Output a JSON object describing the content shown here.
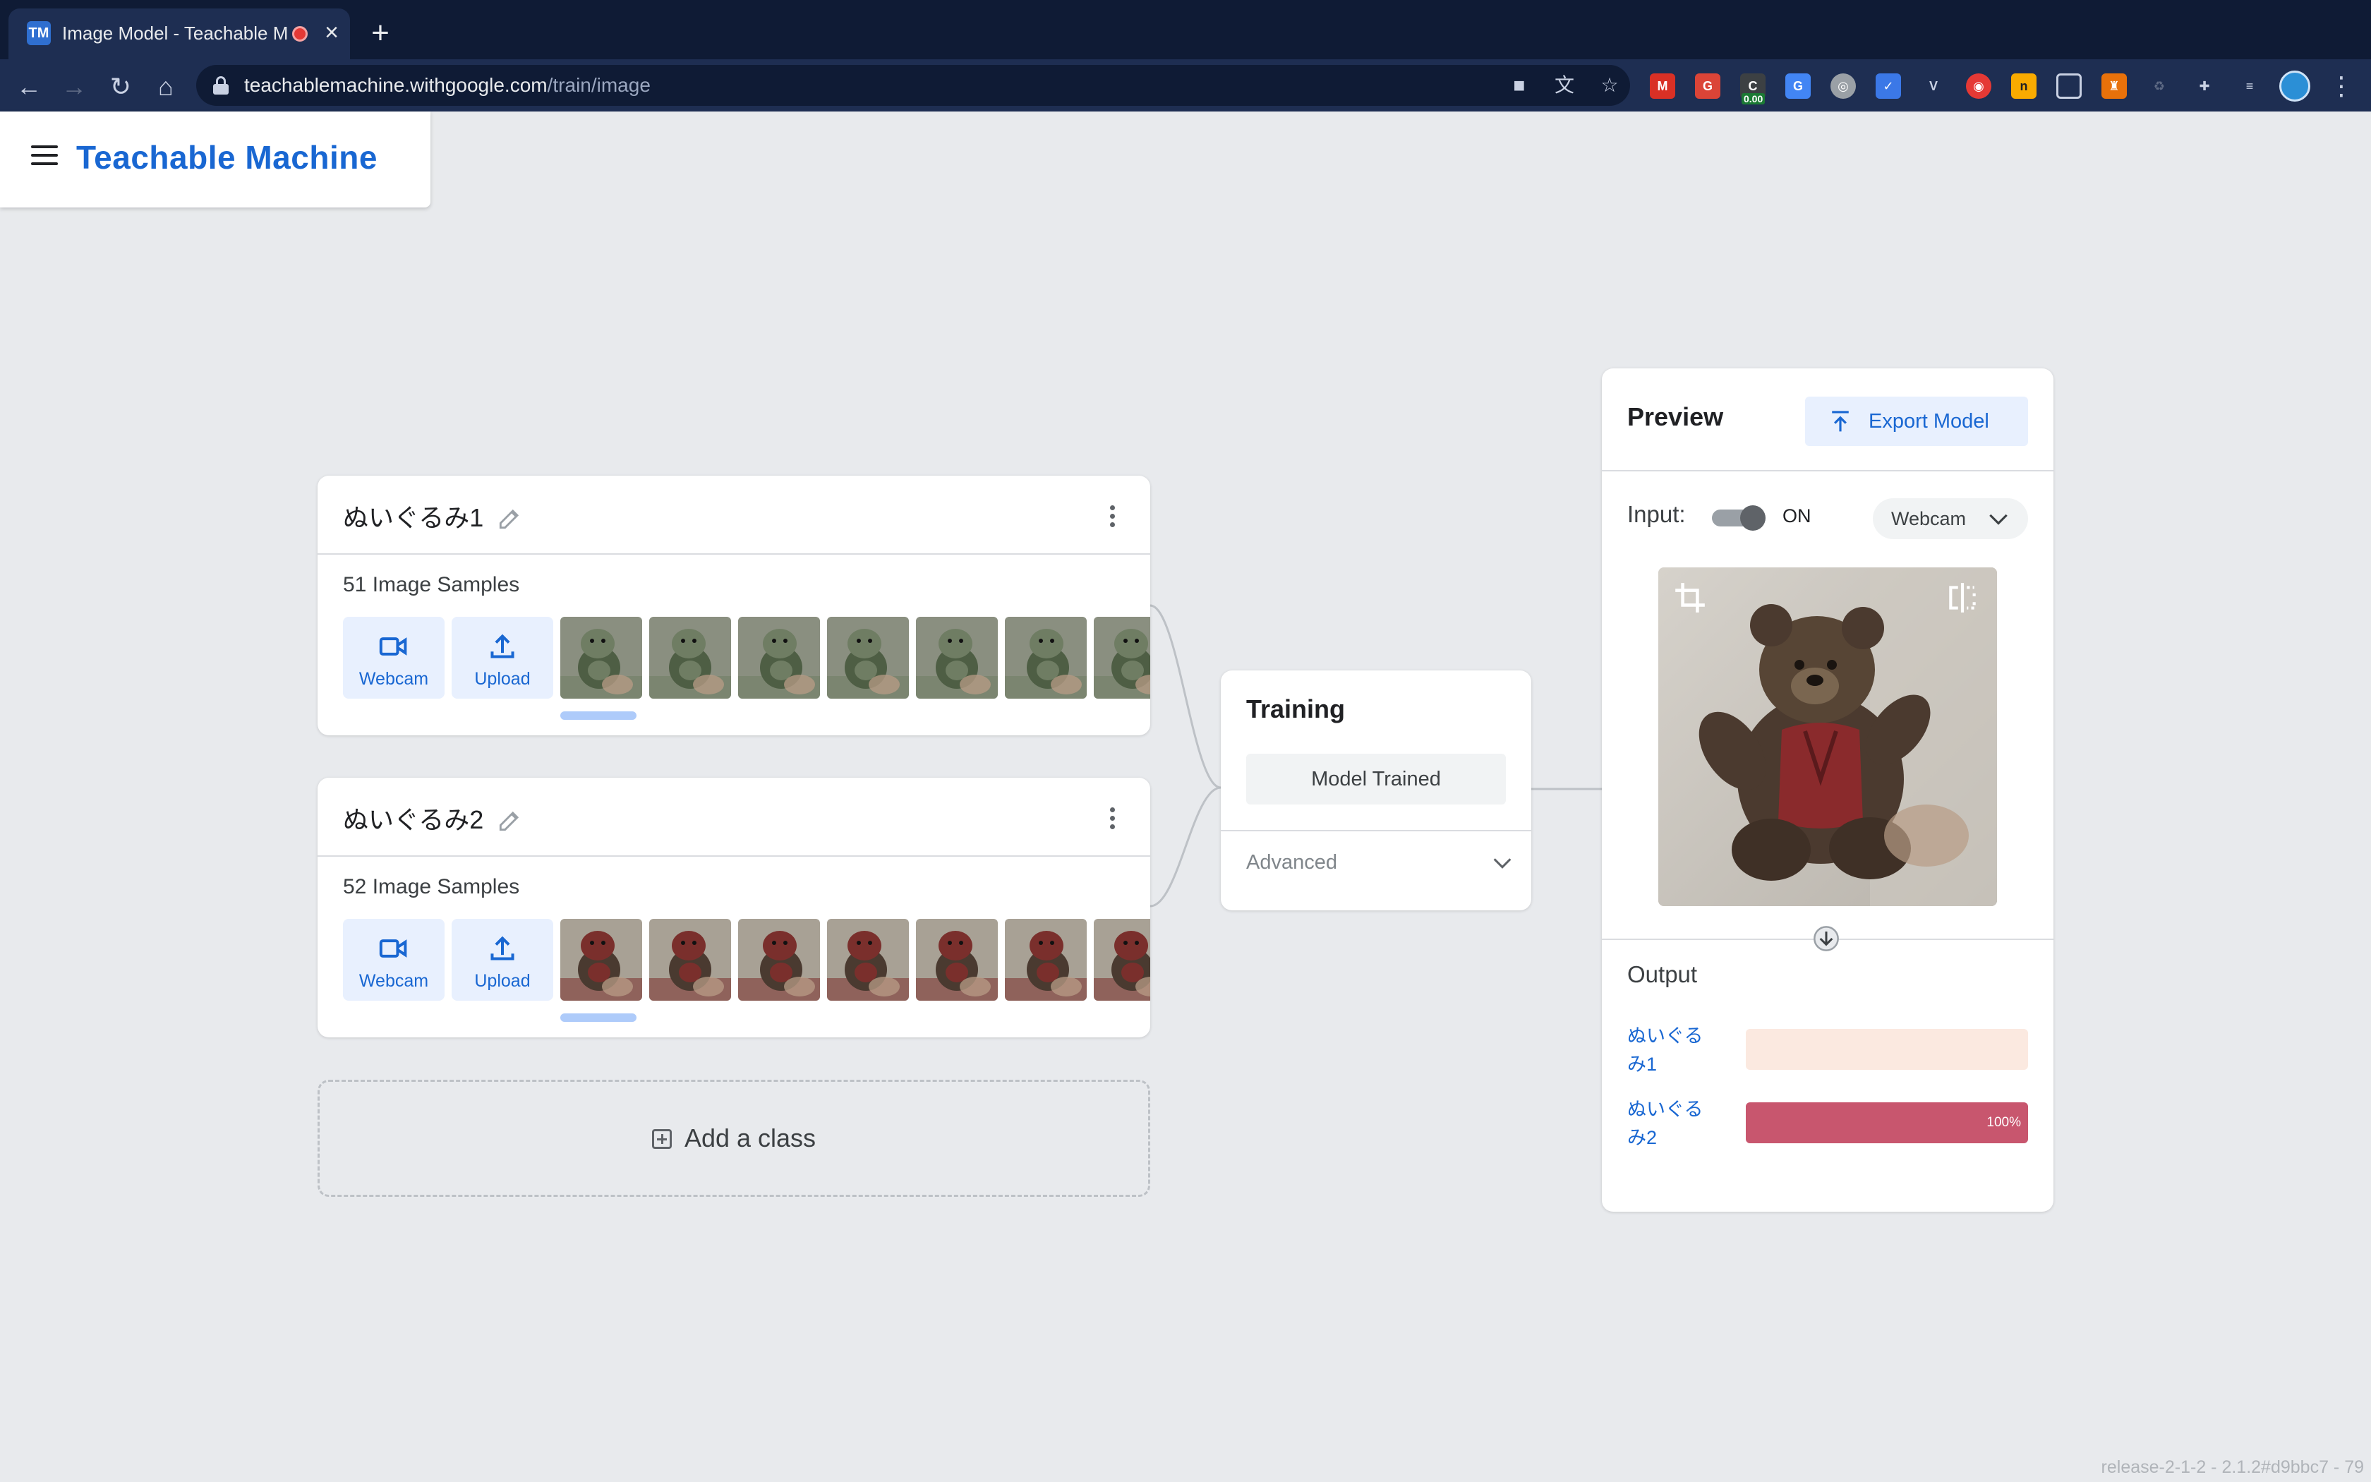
{
  "browser": {
    "tab_title": "Image Model - Teachable Machine",
    "favicon_text": "TM",
    "url_host": "teachablemachine.withgoogle.com",
    "url_path": "/train/image",
    "extension_badge": "0.00"
  },
  "app": {
    "title": "Teachable Machine"
  },
  "classes": [
    {
      "name": "ぬいぐるみ1",
      "sample_count": "51 Image Samples",
      "webcam_label": "Webcam",
      "upload_label": "Upload",
      "thumb_subject": "green frog plush",
      "thumb_colors": [
        "#4e5e44",
        "#6f7d63",
        "#8a8f80"
      ]
    },
    {
      "name": "ぬいぐるみ2",
      "sample_count": "52 Image Samples",
      "webcam_label": "Webcam",
      "upload_label": "Upload",
      "thumb_subject": "teddy bear with red vest",
      "thumb_colors": [
        "#4a3a30",
        "#7a2f2c",
        "#a8a195"
      ]
    }
  ],
  "add_class": {
    "label": "Add a class"
  },
  "training": {
    "title": "Training",
    "button_label": "Model Trained",
    "advanced_label": "Advanced"
  },
  "preview": {
    "title": "Preview",
    "export_label": "Export Model",
    "input_label": "Input:",
    "toggle_state": "ON",
    "source_select": "Webcam",
    "output_title": "Output",
    "outputs": [
      {
        "label": "ぬいぐるみ1",
        "value": 0,
        "percent_text": "",
        "color": "#fbe9e0",
        "fill": "#e8795a"
      },
      {
        "label": "ぬいぐるみ2",
        "value": 1.0,
        "percent_text": "100%",
        "color": "#f3d3db",
        "fill": "#c8566e"
      }
    ]
  },
  "footer": {
    "version": "release-2-1-2 - 2.1.2#d9bbc7 - 79"
  },
  "colors": {
    "accent": "#1967d2",
    "accent_bg": "#e8f0fe",
    "page_bg": "#e8eaed"
  }
}
